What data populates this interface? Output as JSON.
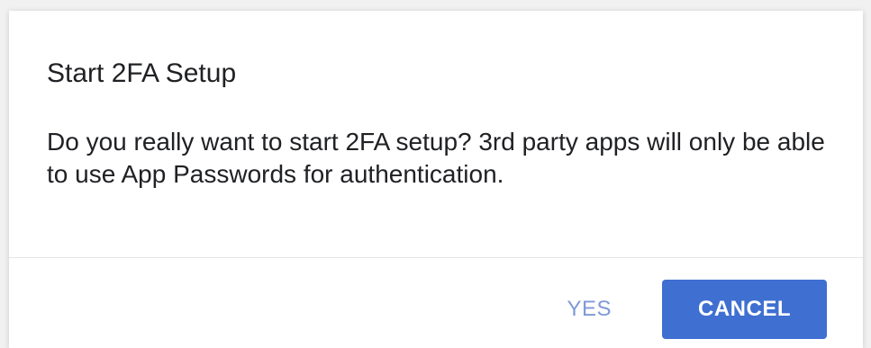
{
  "dialog": {
    "title": "Start 2FA Setup",
    "message": "Do you really want to start 2FA setup? 3rd party apps will only be able to use App Passwords for authentication.",
    "actions": {
      "yes_label": "YES",
      "cancel_label": "CANCEL"
    }
  },
  "colors": {
    "primary": "#3f6fd1",
    "text_button": "#7f99d8",
    "text": "#202124"
  }
}
